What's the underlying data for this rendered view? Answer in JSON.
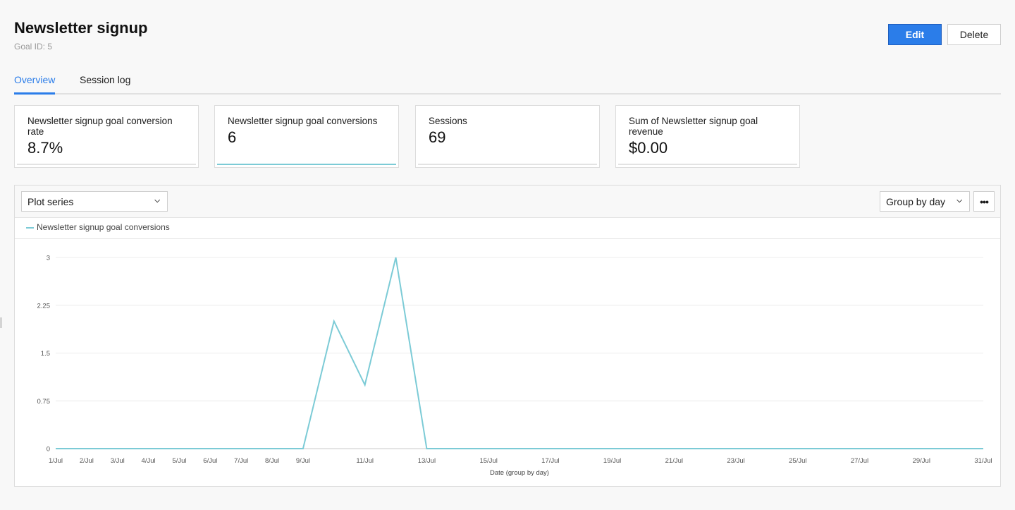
{
  "header": {
    "title": "Newsletter signup",
    "subtitle": "Goal ID: 5",
    "edit_label": "Edit",
    "delete_label": "Delete"
  },
  "tabs": [
    {
      "label": "Overview",
      "active": true
    },
    {
      "label": "Session log",
      "active": false
    }
  ],
  "cards": [
    {
      "label": "Newsletter signup goal conversion rate",
      "value": "8.7%",
      "active": false
    },
    {
      "label": "Newsletter signup goal conversions",
      "value": "6",
      "active": true
    },
    {
      "label": "Sessions",
      "value": "69",
      "active": false
    },
    {
      "label": "Sum of Newsletter signup goal revenue",
      "value": "$0.00",
      "active": false
    }
  ],
  "toolbar": {
    "plot_series_label": "Plot series",
    "group_by_label": "Group by day",
    "more_icon": "more-horizontal-icon",
    "chevron_icon": "chevron-down-icon"
  },
  "colors": {
    "accent": "#2b7de9",
    "series": "#7ccbd6"
  },
  "chart_data": {
    "type": "line",
    "title": "",
    "xlabel": "Date (group by day)",
    "ylabel": "",
    "ylim": [
      0,
      3
    ],
    "y_ticks": [
      "0",
      "0.75",
      "1.5",
      "2.25",
      "3"
    ],
    "y_tick_values": [
      0,
      0.75,
      1.5,
      2.25,
      3
    ],
    "grid": true,
    "legend_position": "top-left",
    "x": [
      "1/Jul",
      "2/Jul",
      "3/Jul",
      "4/Jul",
      "5/Jul",
      "6/Jul",
      "7/Jul",
      "8/Jul",
      "9/Jul",
      "10/Jul",
      "11/Jul",
      "12/Jul",
      "13/Jul",
      "14/Jul",
      "15/Jul",
      "16/Jul",
      "17/Jul",
      "18/Jul",
      "19/Jul",
      "20/Jul",
      "21/Jul",
      "22/Jul",
      "23/Jul",
      "24/Jul",
      "25/Jul",
      "26/Jul",
      "27/Jul",
      "28/Jul",
      "29/Jul",
      "30/Jul",
      "31/Jul"
    ],
    "x_tick_labels": [
      "1/Jul",
      "2/Jul",
      "3/Jul",
      "4/Jul",
      "5/Jul",
      "6/Jul",
      "7/Jul",
      "8/Jul",
      "9/Jul",
      "11/Jul",
      "13/Jul",
      "15/Jul",
      "17/Jul",
      "19/Jul",
      "21/Jul",
      "23/Jul",
      "25/Jul",
      "27/Jul",
      "29/Jul",
      "31/Jul"
    ],
    "series": [
      {
        "name": "Newsletter signup goal conversions",
        "values": [
          0,
          0,
          0,
          0,
          0,
          0,
          0,
          0,
          0,
          2,
          1,
          3,
          0,
          0,
          0,
          0,
          0,
          0,
          0,
          0,
          0,
          0,
          0,
          0,
          0,
          0,
          0,
          0,
          0,
          0,
          0
        ]
      }
    ]
  }
}
